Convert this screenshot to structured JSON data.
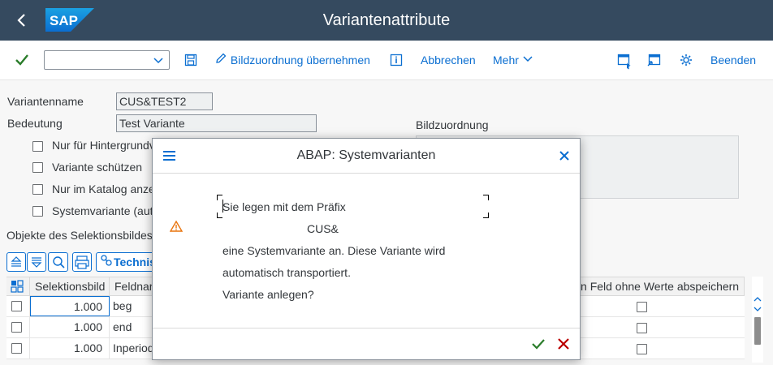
{
  "shell": {
    "title": "Variantenattribute",
    "logo": "SAP"
  },
  "toolbar": {
    "command_value": "",
    "bild_label": "Bildzuordnung übernehmen",
    "abbrechen_label": "Abbrechen",
    "mehr_label": "Mehr",
    "beenden_label": "Beenden"
  },
  "form": {
    "variantenname_label": "Variantenname",
    "variantenname_value": "CUS&TEST2",
    "bedeutung_label": "Bedeutung",
    "bedeutung_value": "Test Variante",
    "bildzuordnung_label": "Bildzuordnung",
    "checkboxes": [
      {
        "label": "Nur für Hintergrundv"
      },
      {
        "label": "Variante schützen"
      },
      {
        "label": "Nur im Katalog anze"
      },
      {
        "label": "Systemvariante (auto"
      }
    ],
    "objekte_label": "Objekte des Selektionsbildes"
  },
  "table": {
    "techn_label": "Technis",
    "headers": {
      "selektionsbild": "Selektionsbild",
      "feldname": "Feldnar",
      "feld_ohne": "Feld ohne Werte abspeichern"
    },
    "rows": [
      {
        "selektionsbild": "1.000",
        "feldname": "beg"
      },
      {
        "selektionsbild": "1.000",
        "feldname": "end"
      },
      {
        "selektionsbild": "1.000",
        "feldname": "Inperiod"
      }
    ]
  },
  "dialog": {
    "title": "ABAP: Systemvarianten",
    "line1": "Sie legen mit dem Präfix",
    "prefix": "CUS&",
    "line2": "eine Systemvariante an. Diese Variante wird",
    "line3": "automatisch transportiert.",
    "line4": "Variante anlegen?"
  },
  "colors": {
    "shell": "#354a5f",
    "accent": "#0a6ed1",
    "confirm": "#2b7d2b",
    "cancel": "#bb0000",
    "warning": "#e9730c"
  }
}
